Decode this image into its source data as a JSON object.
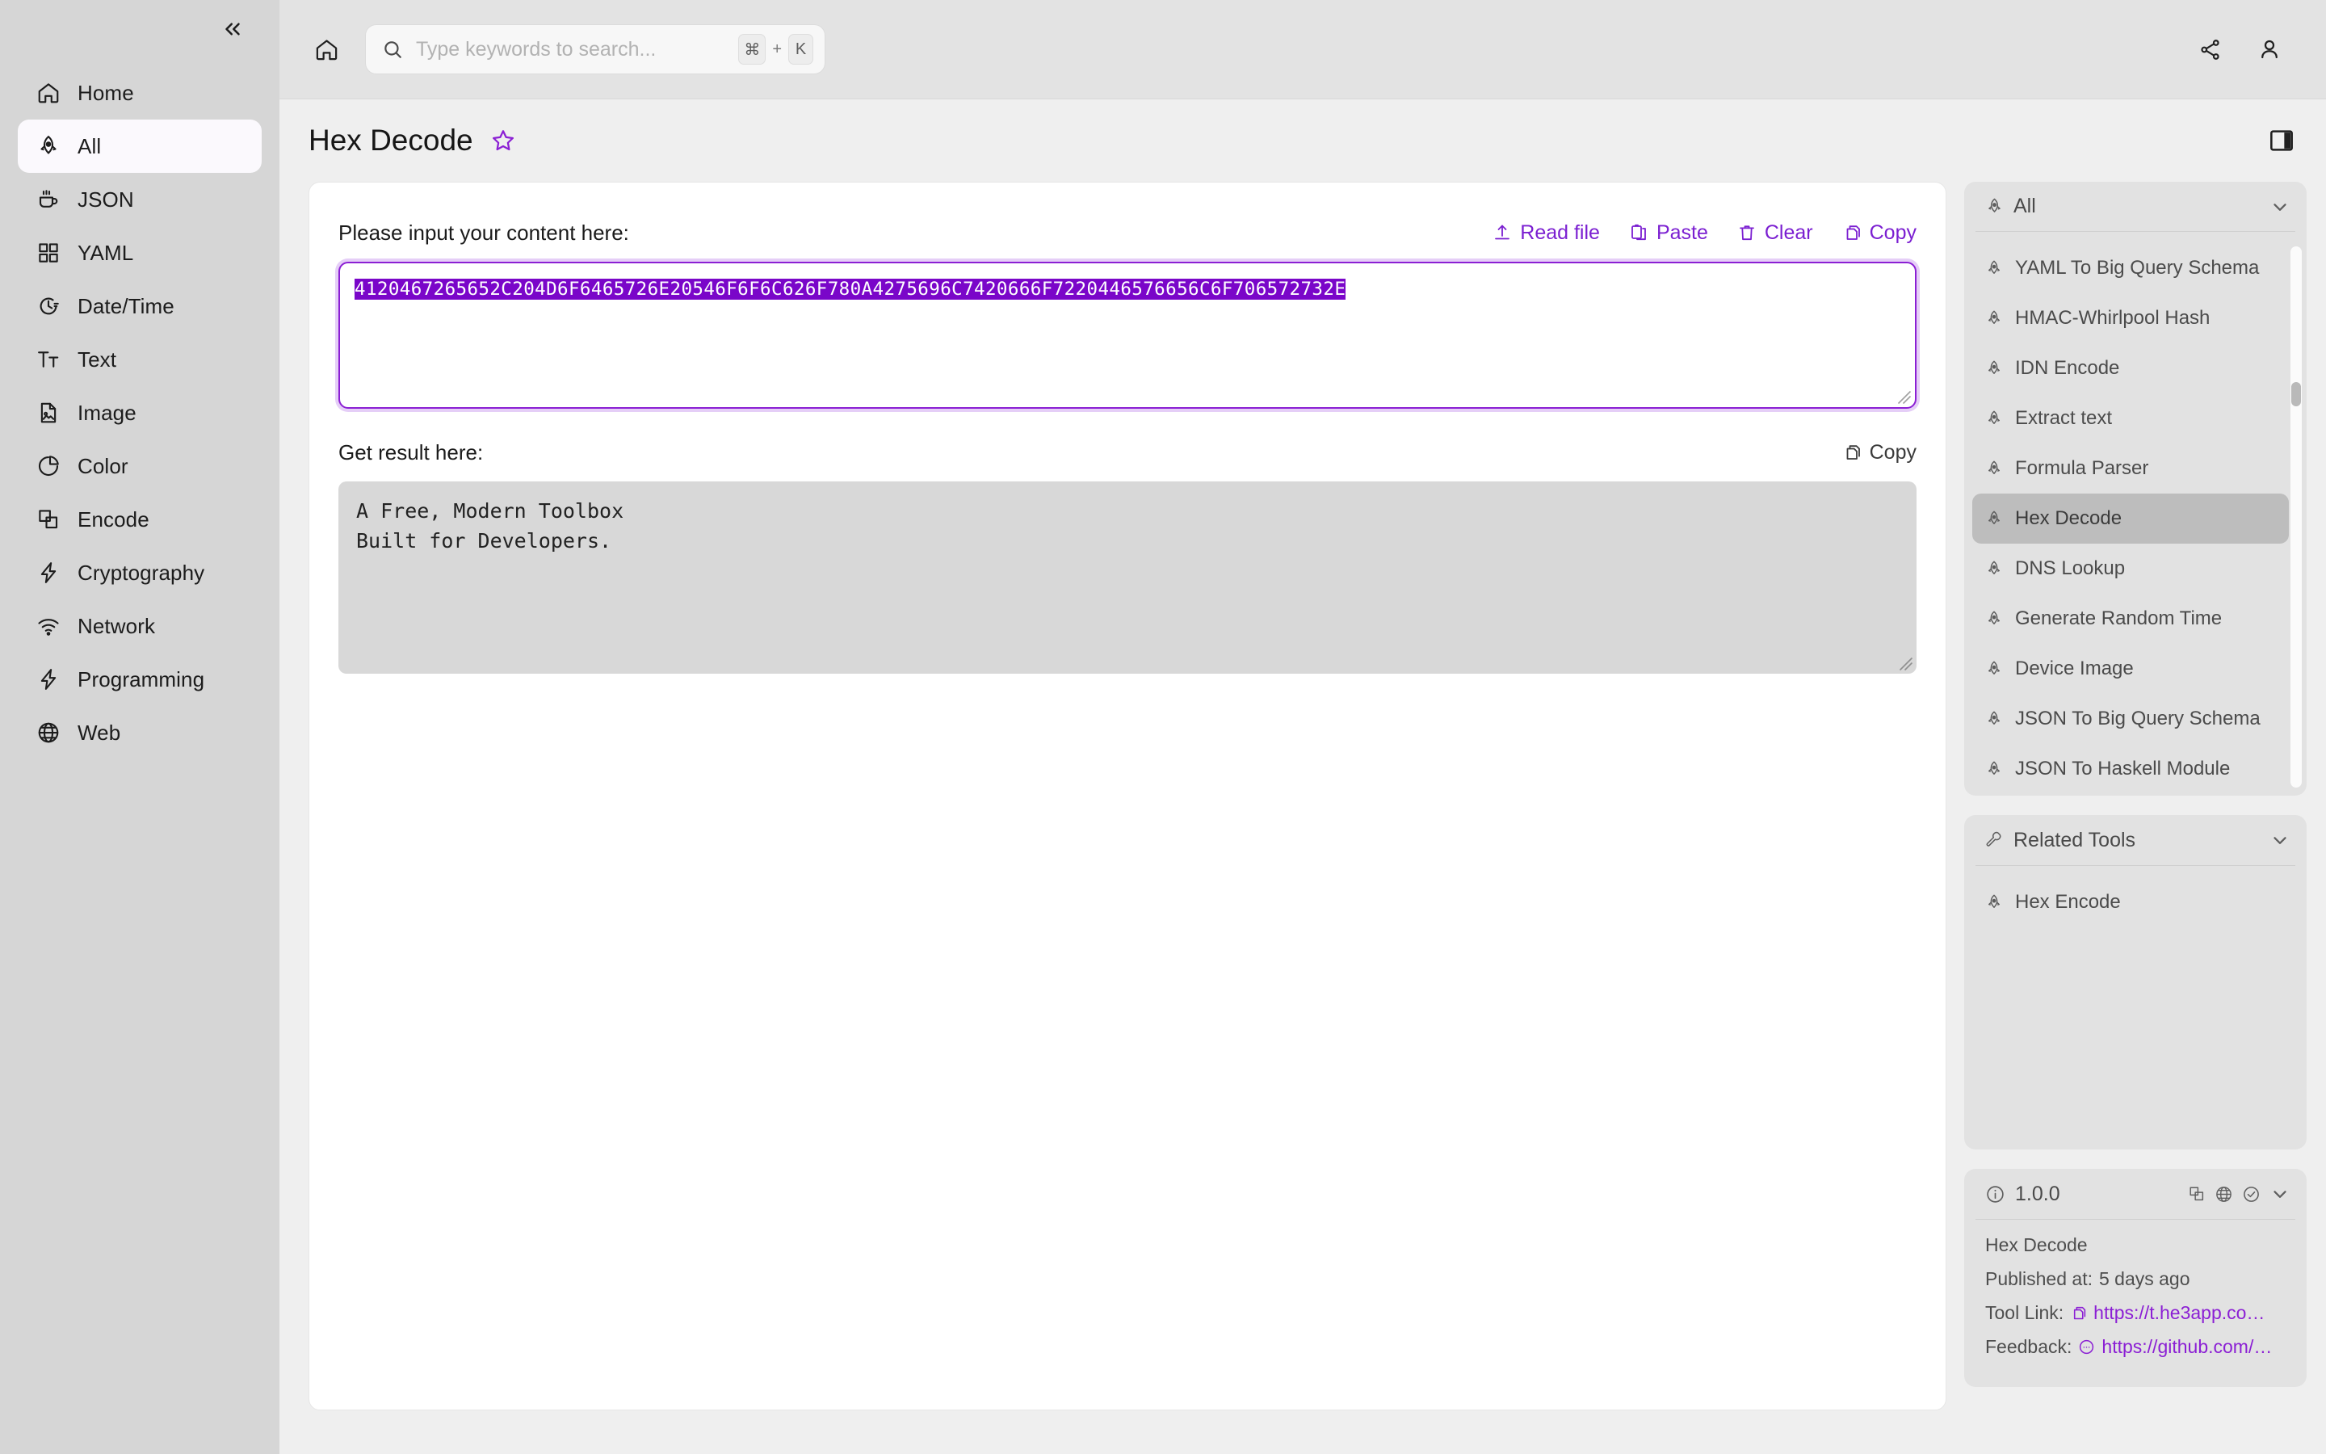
{
  "sidebar": {
    "collapse_icon": "chevrons-left-icon",
    "items": [
      {
        "label": "Home",
        "icon": "home-icon",
        "active": false
      },
      {
        "label": "All",
        "icon": "rocket-icon",
        "active": true
      },
      {
        "label": "JSON",
        "icon": "coffee-cup-icon",
        "active": false
      },
      {
        "label": "YAML",
        "icon": "grid-icon",
        "active": false
      },
      {
        "label": "Date/Time",
        "icon": "clock-icon",
        "active": false
      },
      {
        "label": "Text",
        "icon": "text-format-icon",
        "active": false
      },
      {
        "label": "Image",
        "icon": "image-file-icon",
        "active": false
      },
      {
        "label": "Color",
        "icon": "pie-chart-icon",
        "active": false
      },
      {
        "label": "Encode",
        "icon": "copy-layers-icon",
        "active": false
      },
      {
        "label": "Cryptography",
        "icon": "bolt-icon",
        "active": false
      },
      {
        "label": "Network",
        "icon": "wifi-icon",
        "active": false
      },
      {
        "label": "Programming",
        "icon": "bolt-icon",
        "active": false
      },
      {
        "label": "Web",
        "icon": "globe-icon",
        "active": false
      }
    ]
  },
  "topbar": {
    "home_icon": "home-icon",
    "search": {
      "icon": "search-icon",
      "placeholder": "Type keywords to search...",
      "value": "",
      "shortcut_key": "⌘",
      "shortcut_plus": "+",
      "shortcut_letter": "K"
    },
    "share_icon": "share-icon",
    "account_icon": "user-account-icon"
  },
  "page": {
    "title": "Hex Decode",
    "favorite_icon": "star-outline-icon",
    "favorite_color": "#8b1fd4",
    "panel_toggle_icon": "right-panel-toggle-icon"
  },
  "input_section": {
    "label": "Please input your content here:",
    "actions": [
      {
        "label": "Read file",
        "icon": "upload-icon",
        "color": "#7b1fd1"
      },
      {
        "label": "Paste",
        "icon": "clipboard-icon",
        "color": "#7b1fd1"
      },
      {
        "label": "Clear",
        "icon": "trash-icon",
        "color": "#7b1fd1"
      },
      {
        "label": "Copy",
        "icon": "copy-icon",
        "color": "#7b1fd1"
      }
    ],
    "value": "4120467265652C204D6F6465726E20546F6F6C626F780A4275696C7420666F7220446576656C6F706572732E",
    "selection_bg": "#7a06c9",
    "selection_fg": "#ffffff",
    "border_color": "#8b1fd4"
  },
  "result_section": {
    "label": "Get result here:",
    "copy_label": "Copy",
    "copy_icon": "copy-icon",
    "value": "A Free, Modern Toolbox\nBuilt for Developers."
  },
  "right_rail": {
    "tools_panel": {
      "title": "All",
      "head_icon": "rocket-icon",
      "chevron_icon": "chevron-down-icon",
      "items": [
        {
          "label": "YAML To Big Query Schema",
          "selected": false
        },
        {
          "label": "HMAC-Whirlpool Hash",
          "selected": false
        },
        {
          "label": "IDN Encode",
          "selected": false
        },
        {
          "label": "Extract text",
          "selected": false
        },
        {
          "label": "Formula Parser",
          "selected": false
        },
        {
          "label": "Hex Decode",
          "selected": true
        },
        {
          "label": "DNS Lookup",
          "selected": false
        },
        {
          "label": "Generate Random Time",
          "selected": false
        },
        {
          "label": "Device Image",
          "selected": false
        },
        {
          "label": "JSON To Big Query Schema",
          "selected": false
        },
        {
          "label": "JSON To Haskell Module",
          "selected": false
        }
      ]
    },
    "related_panel": {
      "title": "Related Tools",
      "head_icon": "wrench-icon",
      "chevron_icon": "chevron-down-icon",
      "items": [
        {
          "label": "Hex Encode",
          "selected": false
        }
      ]
    },
    "version_panel": {
      "version": "1.0.0",
      "info_icon": "info-circle-icon",
      "actions": [
        "copy-layers-icon",
        "globe-icon",
        "check-circle-icon",
        "chevron-down-icon"
      ],
      "tool_name": "Hex Decode",
      "published_label": "Published at:",
      "published_value": "5 days ago",
      "tool_link_label": "Tool Link:",
      "tool_link_icon": "copy-icon",
      "tool_link_value": "https://t.he3app.co…",
      "feedback_label": "Feedback:",
      "feedback_icon": "chat-bubble-icon",
      "feedback_value": "https://github.com/…"
    }
  },
  "theme": {
    "accent": "#8b1fd4",
    "sidebar_bg": "#d6d6d6",
    "page_bg": "#efefef",
    "card_bg": "#ffffff",
    "rail_card_bg": "#e2e2e2",
    "output_bg": "#d8d8d8"
  }
}
